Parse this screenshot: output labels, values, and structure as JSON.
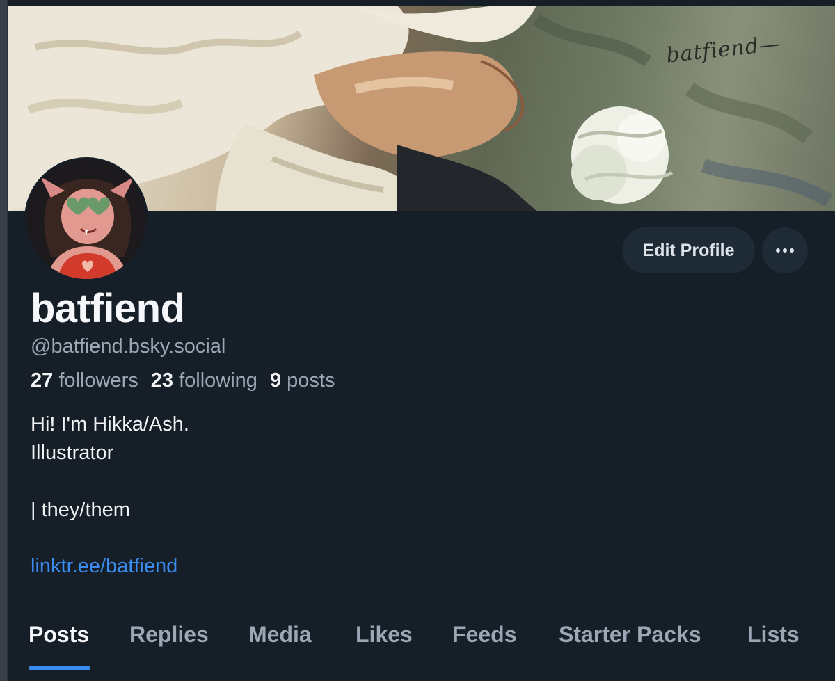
{
  "banner": {
    "signature_text": "batfiend—"
  },
  "profile": {
    "display_name": "batfiend",
    "handle": "@batfiend.bsky.social",
    "stats": {
      "followers_count": "27",
      "followers_label": "followers",
      "following_count": "23",
      "following_label": "following",
      "posts_count": "9",
      "posts_label": "posts"
    },
    "bio_lines": [
      "Hi! I'm Hikka/Ash.",
      "Illustrator",
      "",
      "| they/them",
      ""
    ],
    "link": "linktr.ee/batfiend"
  },
  "actions": {
    "edit_profile_label": "Edit Profile",
    "more_icon": "ellipsis-icon"
  },
  "tabs": [
    {
      "label": "Posts",
      "active": true
    },
    {
      "label": "Replies",
      "active": false
    },
    {
      "label": "Media",
      "active": false
    },
    {
      "label": "Likes",
      "active": false
    },
    {
      "label": "Feeds",
      "active": false
    },
    {
      "label": "Starter Packs",
      "active": false
    },
    {
      "label": "Lists",
      "active": false
    }
  ],
  "colors": {
    "background": "#161e27",
    "accent": "#3b8cf0",
    "muted_text": "#9ba7b5",
    "button_bg": "#1f2a37"
  }
}
